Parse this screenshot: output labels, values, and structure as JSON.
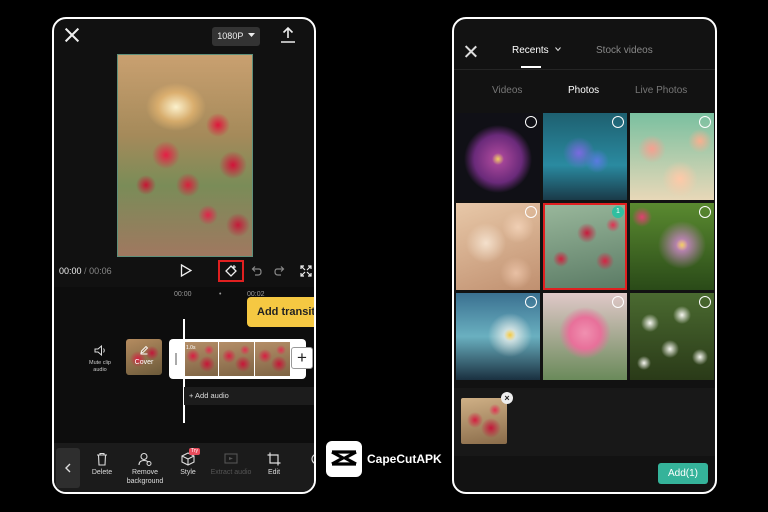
{
  "editor": {
    "resolution_label": "1080P",
    "time_current": "00:00",
    "time_separator": "/",
    "time_total": "00:06",
    "ruler": {
      "mark_0": "00:00",
      "mark_1": "•",
      "mark_2": "00:02"
    },
    "tooltip": "Add transiti",
    "mute_label_line1": "Mute clip",
    "mute_label_line2": "audio",
    "cover_label": "Cover",
    "clip_time": "1.0s",
    "add_clip_symbol": "+",
    "add_audio_label": "+ Add audio",
    "toolbar": {
      "items": [
        {
          "label": "Delete",
          "icon": "trash-icon"
        },
        {
          "label": "Remove background",
          "icon": "remove-background-icon"
        },
        {
          "label": "Style",
          "icon": "style-cube-icon",
          "badge": "Try"
        },
        {
          "label": "Extract audio",
          "icon": "extract-audio-icon",
          "disabled": true
        },
        {
          "label": "Edit",
          "icon": "crop-icon"
        },
        {
          "label": "F",
          "icon": "filter-icon"
        }
      ]
    }
  },
  "brand": {
    "name": "CapeCutAPK"
  },
  "picker": {
    "tabs": {
      "recents": "Recents",
      "stock": "Stock videos"
    },
    "subtabs": {
      "videos": "Videos",
      "photos": "Photos",
      "live": "Live Photos"
    },
    "selected_count_badge": "1",
    "tray_remove_symbol": "×",
    "add_button_label": "Add(1)"
  },
  "colors": {
    "accent_teal": "#35b39a",
    "highlight_red": "#e02020",
    "tooltip_yellow": "#f5c842",
    "background": "#000000"
  }
}
